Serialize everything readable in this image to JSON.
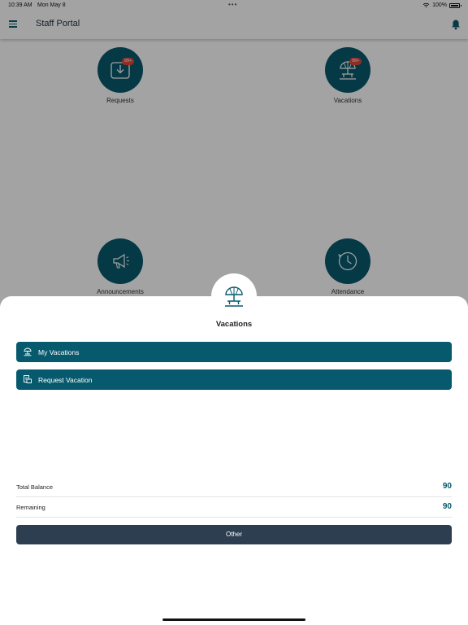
{
  "status_bar": {
    "time": "10:39 AM",
    "date": "Mon May 8",
    "battery": "100%",
    "multitask_dots": "•••"
  },
  "app_bar": {
    "title": "Staff Portal",
    "menu_icon": "hamburger-menu-icon",
    "notification_icon": "bell-icon"
  },
  "dashboard": {
    "tiles": [
      {
        "label": "Requests",
        "badge": "99+",
        "icon": "inbox-download-icon"
      },
      {
        "label": "Vacations",
        "badge": "99+",
        "icon": "beach-umbrella-chair-icon"
      },
      {
        "label": "Announcements",
        "icon": "megaphone-icon"
      },
      {
        "label": "Attendance",
        "icon": "clock-icon"
      }
    ]
  },
  "sheet": {
    "title": "Vacations",
    "icon": "beach-umbrella-chair-icon",
    "actions": [
      {
        "label": "My Vacations",
        "icon": "beach-umbrella-icon"
      },
      {
        "label": "Request Vacation",
        "icon": "request-form-icon"
      }
    ],
    "summary": [
      {
        "label": "Total Balance",
        "value": "90"
      },
      {
        "label": "Remaining",
        "value": "90"
      }
    ],
    "other_label": "Other"
  },
  "colors": {
    "primary": "#075a6d",
    "badge": "#e4473b",
    "other_button": "#2c3e50"
  }
}
